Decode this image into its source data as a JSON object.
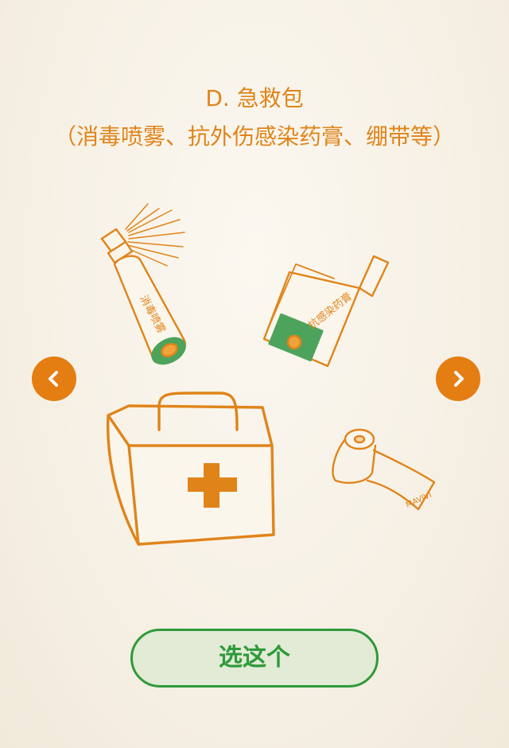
{
  "option": {
    "title": "D. 急救包",
    "subtitle": "（消毒喷雾、抗外伤感染药膏、绷带等）"
  },
  "illustration": {
    "spray_label": "消毒喷雾",
    "tube_label": "抗感染药膏",
    "bandage_label": "MAVIVI"
  },
  "navigation": {
    "prev_icon": "chevron-left-icon",
    "next_icon": "chevron-right-icon"
  },
  "actions": {
    "choose_label": "选这个"
  },
  "colors": {
    "accent": "#e0841a",
    "nav": "#e47d12",
    "choose_text": "#2f9a3a",
    "choose_bg": "#e1ebd5",
    "medical_green": "#3f9e55"
  }
}
